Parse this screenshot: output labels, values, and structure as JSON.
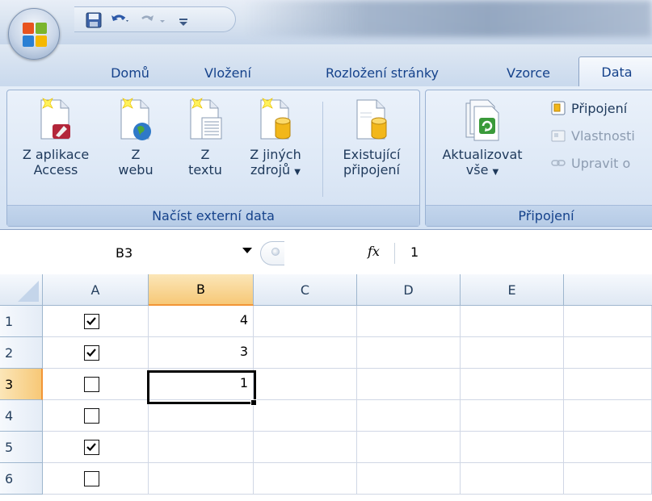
{
  "tabs": {
    "home": "Domů",
    "insert": "Vložení",
    "page_layout": "Rozložení stránky",
    "formulas": "Vzorce",
    "data": "Data"
  },
  "ribbon": {
    "external_data": {
      "label": "Načíst externí data",
      "access": {
        "line1": "Z aplikace",
        "line2": "Access",
        "icon": "access-database-icon"
      },
      "web": {
        "line1": "Z",
        "line2": "webu",
        "icon": "web-globe-icon"
      },
      "text": {
        "line1": "Z",
        "line2": "textu",
        "icon": "text-file-icon"
      },
      "other": {
        "line1": "Z jiných",
        "line2": "zdrojů",
        "icon": "database-cylinder-icon"
      },
      "existing": {
        "line1": "Existující",
        "line2": "připojení",
        "icon": "existing-connections-icon"
      }
    },
    "connections": {
      "label": "Připojení",
      "refresh": {
        "line1": "Aktualizovat",
        "line2": "vše",
        "icon": "refresh-icon"
      },
      "connections_item": "Připojení",
      "properties_item": "Vlastnosti",
      "edit_links_item": "Upravit o"
    }
  },
  "formula_bar": {
    "name_box": "B3",
    "fx_label": "fx",
    "value": "1"
  },
  "grid": {
    "columns": [
      "A",
      "B",
      "C",
      "D",
      "E"
    ],
    "selected_column": "B",
    "selected_row": "3",
    "rows": [
      {
        "num": "1",
        "checked": true,
        "b": "4"
      },
      {
        "num": "2",
        "checked": true,
        "b": "3"
      },
      {
        "num": "3",
        "checked": false,
        "b": "1"
      },
      {
        "num": "4",
        "checked": false,
        "b": ""
      },
      {
        "num": "5",
        "checked": true,
        "b": ""
      },
      {
        "num": "6",
        "checked": false,
        "b": ""
      }
    ],
    "active_cell": "B3"
  }
}
